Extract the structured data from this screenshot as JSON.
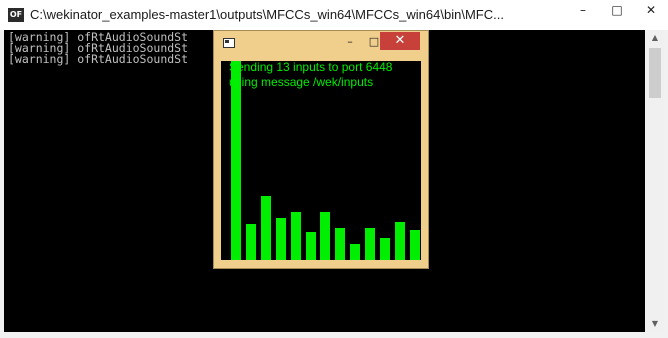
{
  "console": {
    "icon_label": "OF",
    "title": "C:\\wekinator_examples-master1\\outputs\\MFCCs_win64\\MFCCs_win64\\bin\\MFC...",
    "controls": {
      "minimize": "–",
      "maximize": "□",
      "close": "✕"
    },
    "lines": [
      "[warning] ofRtAudioSoundSt                         detected",
      "[warning] ofRtAudioSoundSt                         detected",
      "[warning] ofRtAudioSoundSt                         detected"
    ],
    "text_color": "#c0c0c0",
    "background_color": "#000000"
  },
  "app_window": {
    "controls": {
      "minimize": "–",
      "maximize": "□",
      "close": "✕"
    },
    "frame_color": "#f0cf8c",
    "status_line_1": "Sending 13 inputs to port 6448",
    "status_line_2": "using message /wek/inputs",
    "bar_color": "#00ee00",
    "inputs": [
      1.0,
      0.18,
      0.32,
      0.21,
      0.24,
      0.14,
      0.24,
      0.16,
      0.08,
      0.16,
      0.11,
      0.19,
      0.15
    ]
  }
}
